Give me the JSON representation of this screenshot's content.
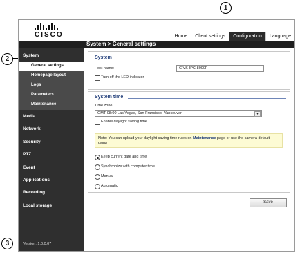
{
  "callouts": [
    "1",
    "2",
    "3"
  ],
  "logo": {
    "text": "CISCO"
  },
  "topnav": {
    "items": [
      "Home",
      "Client settings",
      "Configuration",
      "Language"
    ],
    "active": "Configuration"
  },
  "page_title": "System > General settings",
  "sidebar": {
    "system_label": "System",
    "system_items": [
      "General settings",
      "Homepage layout",
      "Logs",
      "Parameters",
      "Maintenance"
    ],
    "sections": [
      "Media",
      "Network",
      "Security",
      "PTZ",
      "Event",
      "Applications",
      "Recording",
      "Local storage"
    ],
    "version": "Version: 1.0.0.07"
  },
  "system_group": {
    "title": "System",
    "host_name_label": "Host name:",
    "host_name_value": "CIVS-IPC-8000F",
    "led_label": "Turn off the LED indicator"
  },
  "time_group": {
    "title": "System time",
    "time_zone_label": "Time zone:",
    "time_zone_value": "GMT-08:00 Las Vegas, San Francisco, Vancouver",
    "daylight_label": "Enable daylight saving time",
    "note_prefix": "Note: You can upload your daylight saving time rules on ",
    "note_link": "Maintenance",
    "note_suffix": " page or use the camera default value.",
    "radios": [
      "Keep current date and time",
      "Synchronize with computer time",
      "Manual",
      "Automatic"
    ],
    "selected_radio": "Keep current date and time"
  },
  "save_label": "Save"
}
